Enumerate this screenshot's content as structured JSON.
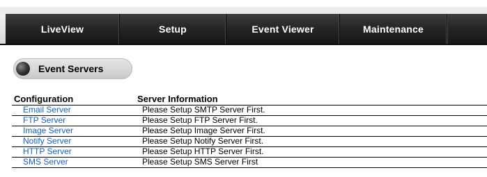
{
  "nav": {
    "items": [
      {
        "label": "LiveView"
      },
      {
        "label": "Setup"
      },
      {
        "label": "Event Viewer"
      },
      {
        "label": "Maintenance"
      }
    ]
  },
  "section": {
    "title": "Event Servers"
  },
  "table": {
    "headers": [
      "Configuration",
      "Server Information"
    ],
    "rows": [
      {
        "server": "Email Server",
        "info": "Please Setup SMTP Server First."
      },
      {
        "server": "FTP Server",
        "info": "Please Setup FTP Server First."
      },
      {
        "server": "Image Server",
        "info": "Please Setup Image Server First."
      },
      {
        "server": "Notify Server",
        "info": "Please Setup Notify Server First."
      },
      {
        "server": "HTTP Server",
        "info": "Please Setup HTTP Server First."
      },
      {
        "server": "SMS Server",
        "info": "Please Setup SMS Server First"
      }
    ]
  },
  "colors": {
    "link": "#1560c9",
    "navbar": "#262626"
  }
}
